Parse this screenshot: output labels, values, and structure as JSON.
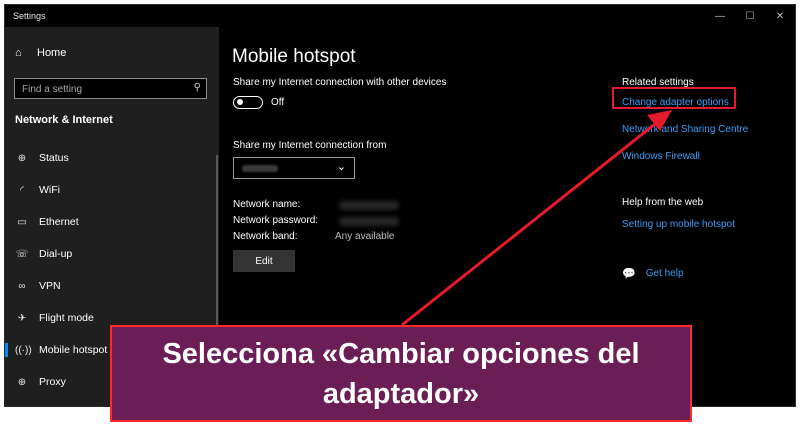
{
  "window": {
    "title": "Settings",
    "controls": [
      "—",
      "☐",
      "✕"
    ]
  },
  "sidebar": {
    "home_label": "Home",
    "search_placeholder": "Find a setting",
    "section_title": "Network & Internet",
    "items": [
      {
        "label": "Status",
        "icon": "globe-icon"
      },
      {
        "label": "WiFi",
        "icon": "wifi-icon"
      },
      {
        "label": "Ethernet",
        "icon": "ethernet-icon"
      },
      {
        "label": "Dial-up",
        "icon": "dialup-icon"
      },
      {
        "label": "VPN",
        "icon": "vpn-icon"
      },
      {
        "label": "Flight mode",
        "icon": "airplane-icon"
      },
      {
        "label": "Mobile hotspot",
        "icon": "hotspot-icon",
        "active": true
      },
      {
        "label": "Proxy",
        "icon": "proxy-globe-icon"
      }
    ]
  },
  "main": {
    "title": "Mobile hotspot",
    "share_label": "Share my Internet connection with other devices",
    "toggle_state": "Off",
    "share_from_label": "Share my Internet connection from",
    "network_name_label": "Network name:",
    "network_password_label": "Network password:",
    "network_band_label": "Network band:",
    "network_band_value": "Any available",
    "edit_button": "Edit"
  },
  "related": {
    "heading": "Related settings",
    "links": [
      "Change adapter options",
      "Network and Sharing Centre",
      "Windows Firewall"
    ],
    "help_heading": "Help from the web",
    "help_link": "Setting up mobile hotspot",
    "get_help": "Get help"
  },
  "annotation": {
    "text": "Selecciona «Cambiar opciones del adaptador»",
    "accent_color": "#e41b2b",
    "callout_bg": "#6b1d55"
  }
}
